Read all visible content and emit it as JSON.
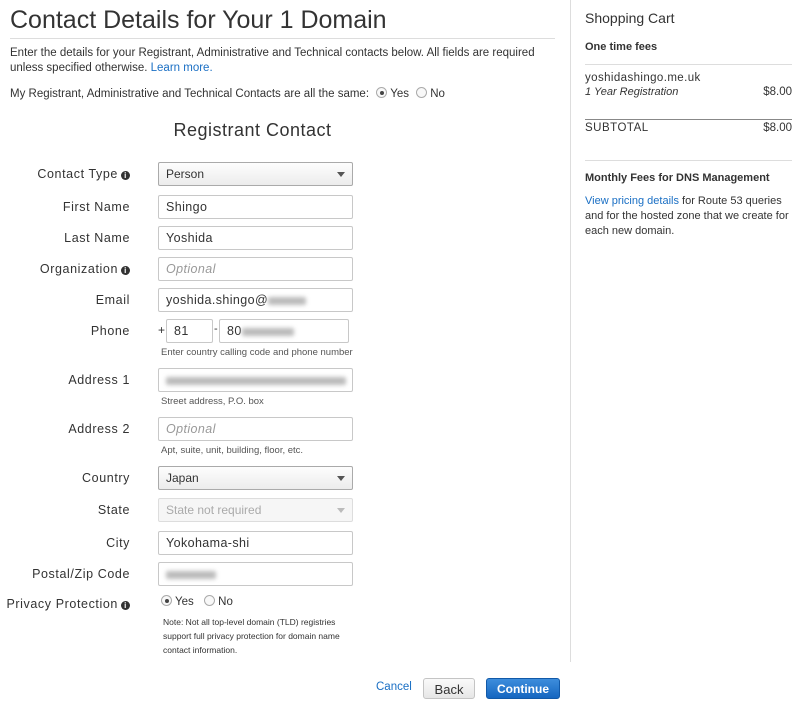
{
  "header": {
    "title": "Contact Details for Your 1 Domain",
    "intro": "Enter the details for your Registrant, Administrative and Technical contacts below. All fields are required unless specified otherwise.",
    "learn_more": "Learn more.",
    "same_question": "My Registrant, Administrative and Technical Contacts are all the same:",
    "yes": "Yes",
    "no": "No",
    "same_selected": "Yes"
  },
  "form": {
    "section_title": "Registrant Contact",
    "contact_type": {
      "label": "Contact Type",
      "value": "Person"
    },
    "first_name": {
      "label": "First Name",
      "value": "Shingo"
    },
    "last_name": {
      "label": "Last Name",
      "value": "Yoshida"
    },
    "organization": {
      "label": "Organization",
      "placeholder": "Optional"
    },
    "email": {
      "label": "Email",
      "value": "yoshida.shingo@"
    },
    "phone": {
      "label": "Phone",
      "plus": "+",
      "code": "81",
      "sep": "-",
      "number": "80",
      "hint": "Enter country calling code and phone number"
    },
    "address1": {
      "label": "Address 1",
      "hint": "Street address, P.O. box"
    },
    "address2": {
      "label": "Address 2",
      "placeholder": "Optional",
      "hint": "Apt, suite, unit, building, floor, etc."
    },
    "country": {
      "label": "Country",
      "value": "Japan"
    },
    "state": {
      "label": "State",
      "value": "State not required"
    },
    "city": {
      "label": "City",
      "value": "Yokohama-shi"
    },
    "postal": {
      "label": "Postal/Zip Code"
    },
    "privacy": {
      "label": "Privacy Protection",
      "yes": "Yes",
      "no": "No",
      "selected": "Yes",
      "note": "Note: Not all top-level domain (TLD) registries support full privacy protection for domain name contact information."
    }
  },
  "cart": {
    "title": "Shopping Cart",
    "one_time": "One time fees",
    "domain": "yoshidashingo.me.uk",
    "item": "1 Year Registration",
    "item_price": "$8.00",
    "subtotal_label": "SUBTOTAL",
    "subtotal": "$8.00",
    "monthly": "Monthly Fees for DNS Management",
    "pricing_link": "View pricing details",
    "pricing_text": " for Route 53 queries and for the hosted zone that we create for each new domain."
  },
  "actions": {
    "cancel": "Cancel",
    "back": "Back",
    "continue": "Continue"
  },
  "colors": {
    "link": "#1a6fc4",
    "primary": "#1a6fc4"
  }
}
